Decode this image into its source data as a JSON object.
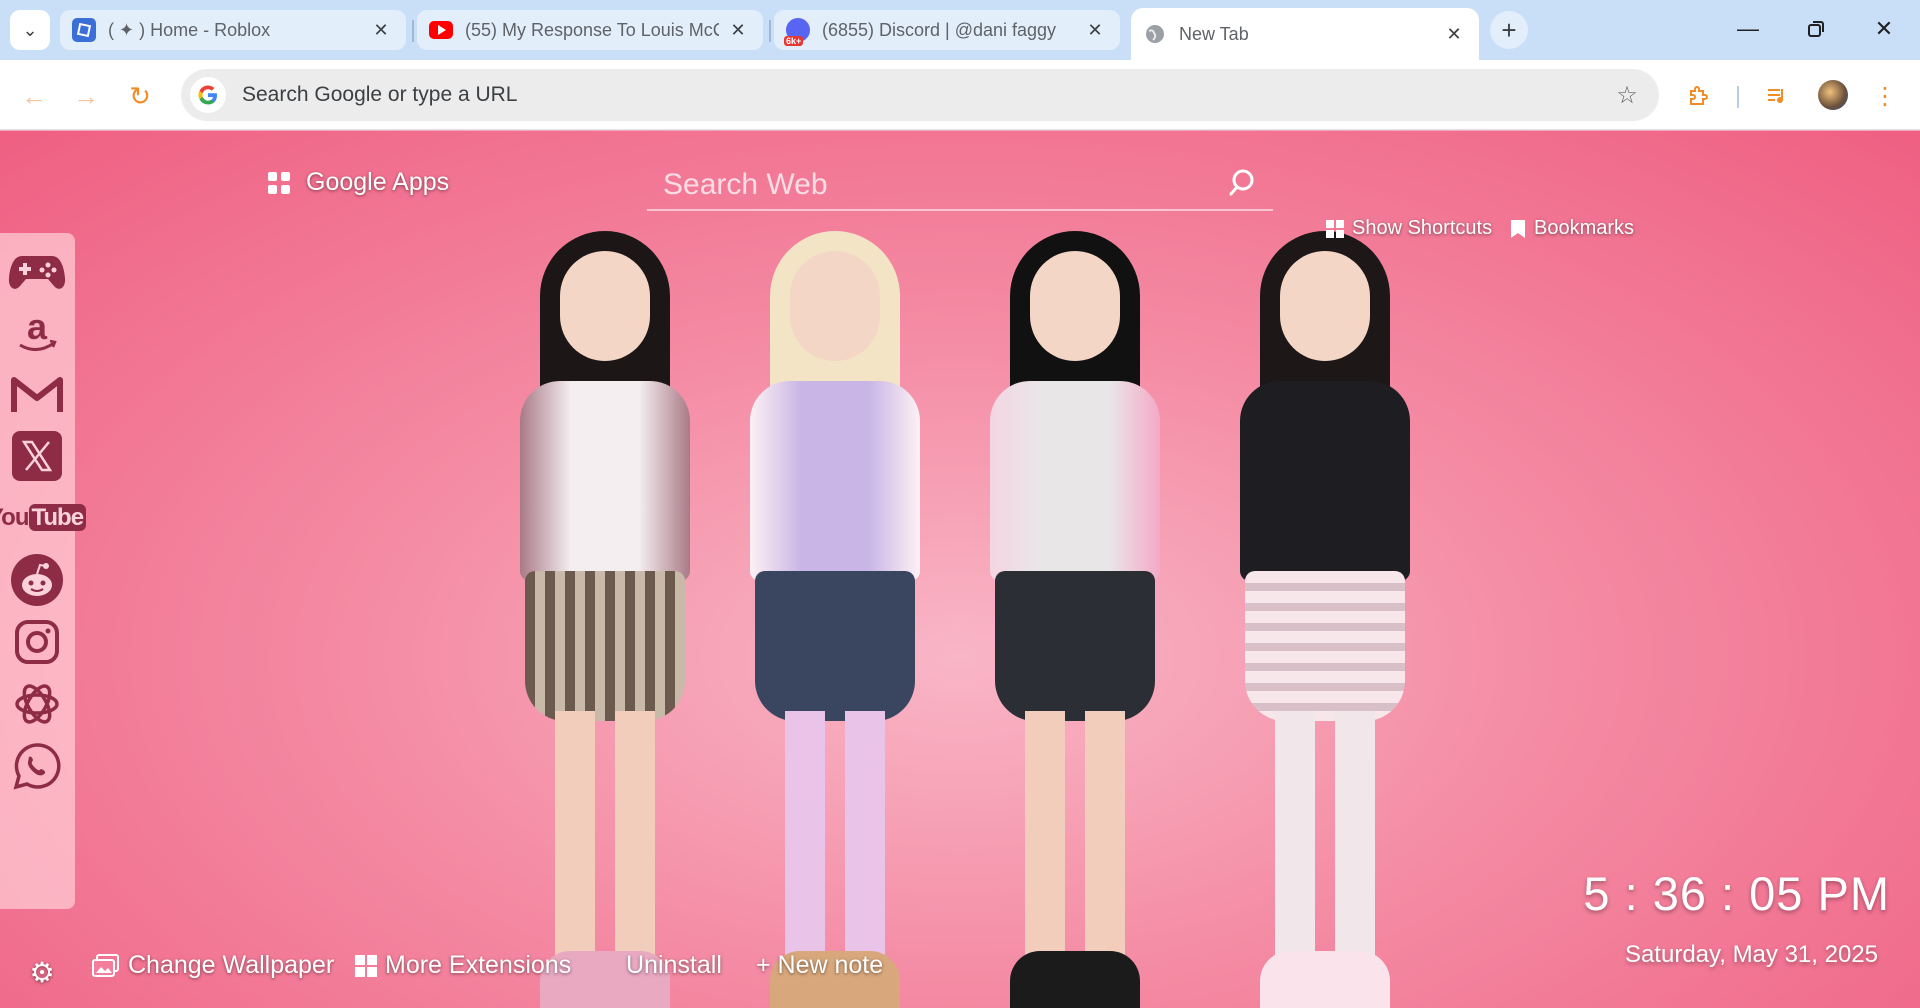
{
  "tabs": [
    {
      "title": "( ✦ ) Home - Roblox",
      "favicon": "roblox-icon",
      "active": false
    },
    {
      "title": "(55) My Response To Louis McC",
      "favicon": "youtube-icon",
      "active": false
    },
    {
      "title": "(6855) Discord | @dani faggy",
      "favicon": "discord-icon",
      "badge": "6k+",
      "active": false
    },
    {
      "title": "New Tab",
      "favicon": "globe-icon",
      "active": true
    }
  ],
  "omnibox": {
    "placeholder": "Search Google or type a URL"
  },
  "ntp": {
    "google_apps": "Google Apps",
    "search_placeholder": "Search Web",
    "show_shortcuts": "Show Shortcuts",
    "bookmarks": "Bookmarks",
    "dock": [
      {
        "name": "gamepad-icon"
      },
      {
        "name": "amazon-icon"
      },
      {
        "name": "gmail-icon"
      },
      {
        "name": "x-twitter-icon"
      },
      {
        "name": "youtube-logo-icon",
        "text_a": "You",
        "text_b": "Tube"
      },
      {
        "name": "reddit-icon"
      },
      {
        "name": "instagram-icon"
      },
      {
        "name": "chatgpt-icon"
      },
      {
        "name": "whatsapp-icon"
      }
    ],
    "bottom": {
      "change_wallpaper": "Change Wallpaper",
      "more_extensions": "More Extensions",
      "uninstall": "Uninstall",
      "new_note": "+ New note"
    },
    "clock": "5 : 36 : 05 PM",
    "date": "Saturday, May 31, 2025"
  },
  "colors": {
    "accent": "#f28c28",
    "dock_icon": "#8e2c46",
    "tab_strip": "#c9dff7"
  }
}
